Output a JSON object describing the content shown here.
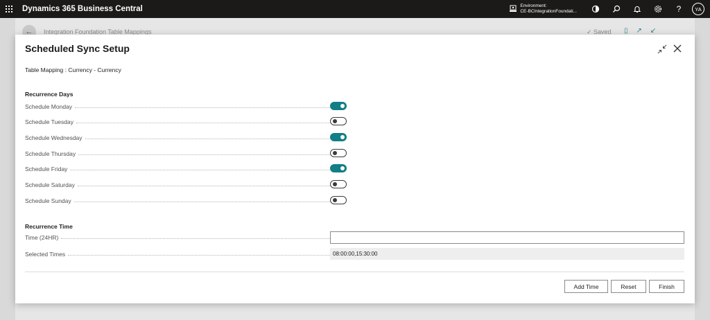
{
  "app": {
    "title": "Dynamics 365 Business Central"
  },
  "topbar": {
    "environment_label": "Environment:",
    "environment_value": "CE-BCIntegrationFoundati...",
    "avatar_initials": "YA",
    "help_glyph": "?"
  },
  "background_page": {
    "title": "Integration Foundation Table Mappings",
    "saved_label": "Saved"
  },
  "dialog": {
    "title": "Scheduled Sync Setup",
    "table_mapping": "Table Mapping : Currency - Currency"
  },
  "recurrence_days": {
    "title": "Recurrence Days",
    "items": [
      {
        "label": "Schedule Monday",
        "enabled": true
      },
      {
        "label": "Schedule Tuesday",
        "enabled": false
      },
      {
        "label": "Schedule Wednesday",
        "enabled": true
      },
      {
        "label": "Schedule Thursday",
        "enabled": false
      },
      {
        "label": "Schedule Friday",
        "enabled": true
      },
      {
        "label": "Schedule Saturday",
        "enabled": false
      },
      {
        "label": "Schedule Sunday",
        "enabled": false
      }
    ]
  },
  "recurrence_time": {
    "title": "Recurrence Time",
    "time_label": "Time (24HR)",
    "time_value": "",
    "selected_label": "Selected Times",
    "selected_value": "08:00:00,15:30:00"
  },
  "actions": {
    "add_time": "Add Time",
    "reset": "Reset",
    "finish": "Finish"
  },
  "colors": {
    "accent": "#117f85",
    "topbar": "#1b1a19"
  }
}
